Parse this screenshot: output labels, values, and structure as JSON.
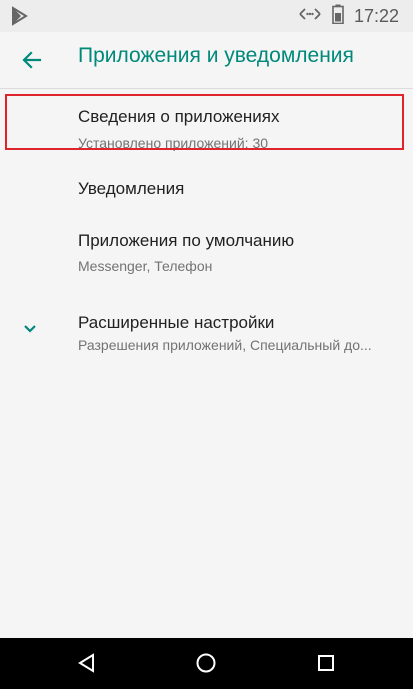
{
  "status_bar": {
    "time": "17:22",
    "icons": [
      "play-store-notification-icon",
      "data-transfer-icon",
      "battery-icon"
    ]
  },
  "app_bar": {
    "title": "Приложения и уведомления",
    "back_icon": "back-arrow-icon"
  },
  "settings": {
    "items": [
      {
        "title": "Сведения о приложениях",
        "subtitle": "Установлено приложений: 30",
        "highlighted": true
      },
      {
        "title": "Уведомления",
        "subtitle": ""
      },
      {
        "title": "Приложения по умолчанию",
        "subtitle": "Messenger, Телефон"
      },
      {
        "title": "Расширенные настройки",
        "subtitle": "Разрешения приложений, Специальный до...",
        "icon": "chevron-down-icon"
      }
    ]
  },
  "nav_bar": {
    "buttons": [
      "back-triangle-icon",
      "home-circle-icon",
      "recents-square-icon"
    ]
  },
  "colors": {
    "accent": "#00897b",
    "highlight": "#e0242b",
    "background": "#f5f5f5",
    "status_bar": "#ededed",
    "nav_bar": "#000000"
  }
}
